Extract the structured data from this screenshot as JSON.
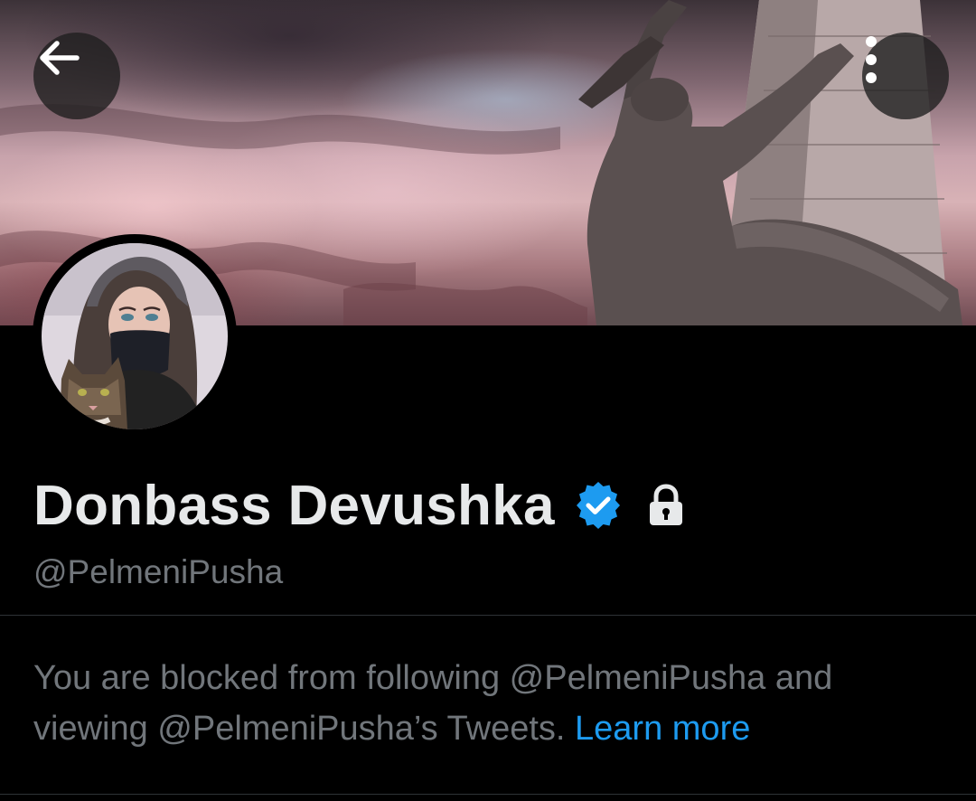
{
  "profile": {
    "display_name": "Donbass Devushka",
    "handle": "@PelmeniPusha",
    "verified": true,
    "protected": true
  },
  "header": {
    "back_icon": "arrow-left-icon",
    "more_icon": "more-vertical-icon"
  },
  "blocked_notice": {
    "text": "You are blocked from following @PelmeniPusha and viewing @PelmeniPusha’s Tweets. ",
    "link_label": "Learn more"
  },
  "colors": {
    "background": "#000000",
    "primary_text": "#e7e9ea",
    "secondary_text": "#71767b",
    "accent": "#1d9bf0",
    "divider": "#2f3336"
  }
}
